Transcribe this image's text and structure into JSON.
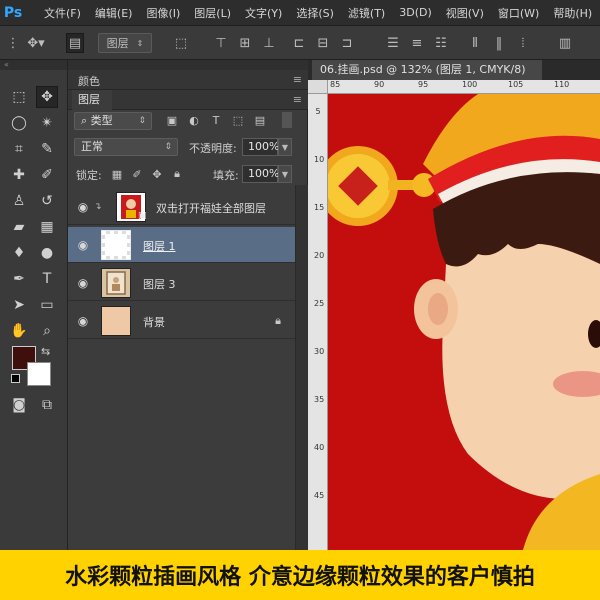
{
  "app": {
    "logo": "Ps"
  },
  "menu": [
    "文件(F)",
    "编辑(E)",
    "图像(I)",
    "图层(L)",
    "文字(Y)",
    "选择(S)",
    "滤镜(T)",
    "3D(D)",
    "视图(V)",
    "窗口(W)",
    "帮助(H)"
  ],
  "options_bar": {
    "layer_select": "图层"
  },
  "panels": {
    "color_tab": "颜色",
    "layers_tab": "图层",
    "filter_type": "类型",
    "blend_mode": "正常",
    "opacity_label": "不透明度:",
    "opacity_value": "100%",
    "lock_label": "锁定:",
    "fill_label": "填充:",
    "fill_value": "100%"
  },
  "layers": [
    {
      "name": "双击打开福娃全部图层",
      "selected": false,
      "locked": false
    },
    {
      "name": "图层 1",
      "selected": true,
      "locked": false
    },
    {
      "name": "图层 3",
      "selected": false,
      "locked": false
    },
    {
      "name": "背景",
      "selected": false,
      "locked": true
    }
  ],
  "document": {
    "tab_title": "06.挂画.psd @ 132% (图层 1, CMYK/8)"
  },
  "rulers": {
    "h_ticks": [
      "85",
      "90",
      "95",
      "100",
      "105",
      "110"
    ],
    "v_ticks": [
      "5",
      "10",
      "15",
      "20",
      "25",
      "30",
      "35",
      "40",
      "45"
    ]
  },
  "colors": {
    "foreground": "#3f0f0b",
    "background": "#ffffff",
    "canvas_red": "#c40d0d",
    "selected_layer": "#5a6d86"
  },
  "caption": "水彩颗粒插画风格 介意边缘颗粒效果的客户慎拍"
}
